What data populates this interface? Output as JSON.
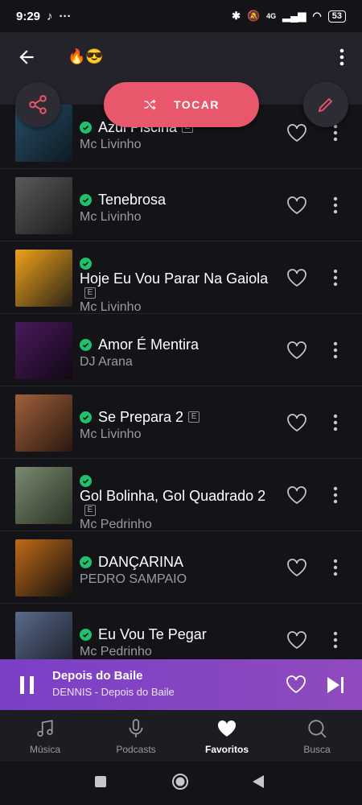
{
  "status": {
    "time": "9:29",
    "battery": "53",
    "network": "4G"
  },
  "header": {
    "title": "🔥😎"
  },
  "actions": {
    "play_label": "TOCAR"
  },
  "tracks": [
    {
      "title": "Azul Piscina",
      "artist": "Mc Livinho",
      "explicit": true,
      "cover": [
        "#274f66",
        "#0e1a22"
      ]
    },
    {
      "title": "Tenebrosa",
      "artist": "Mc Livinho",
      "explicit": false,
      "cover": [
        "#5a5a5a",
        "#1c1c1c"
      ]
    },
    {
      "title": "Hoje Eu Vou Parar Na Gaiola",
      "artist": "Mc Livinho",
      "explicit": true,
      "cover": [
        "#f0a21a",
        "#2a2418"
      ]
    },
    {
      "title": "Amor É Mentira",
      "artist": "DJ Arana",
      "explicit": false,
      "cover": [
        "#4a1a5e",
        "#120814"
      ]
    },
    {
      "title": "Se Prepara 2",
      "artist": "Mc Livinho",
      "explicit": true,
      "cover": [
        "#a0603a",
        "#2a1810"
      ]
    },
    {
      "title": "Gol Bolinha, Gol Quadrado 2",
      "artist": "Mc Pedrinho",
      "explicit": true,
      "cover": [
        "#7a8a70",
        "#2a3224"
      ]
    },
    {
      "title": "DANÇARINA",
      "artist": "PEDRO SAMPAIO",
      "explicit": false,
      "cover": [
        "#c06a18",
        "#141010"
      ]
    },
    {
      "title": "Eu Vou Te Pegar",
      "artist": "Mc Pedrinho",
      "explicit": false,
      "cover": [
        "#5a6a8a",
        "#1a1e28"
      ]
    }
  ],
  "player": {
    "title": "Depois do Baile",
    "subtitle": "DENNIS - Depois do Baile"
  },
  "nav": [
    {
      "label": "Música"
    },
    {
      "label": "Podcasts"
    },
    {
      "label": "Favoritos"
    },
    {
      "label": "Busca"
    }
  ],
  "colors": {
    "accent": "#e8576c",
    "verified": "#1fc26b",
    "player_bg": "#8345c3"
  }
}
